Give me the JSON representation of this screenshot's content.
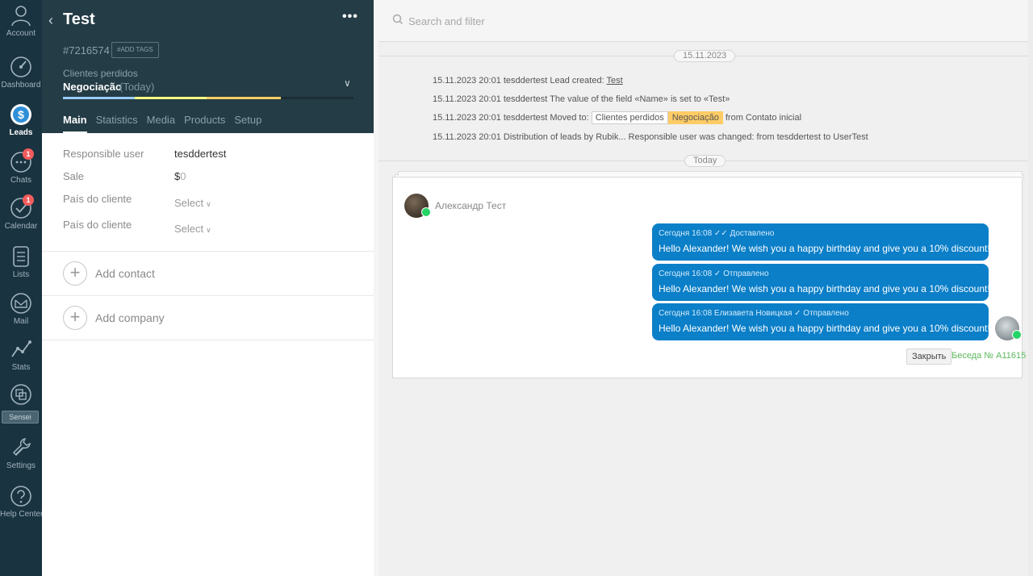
{
  "rail": {
    "items": [
      {
        "label": "Account",
        "icon": "account-icon"
      },
      {
        "label": "Dashboard",
        "icon": "dashboard-icon"
      },
      {
        "label": "Leads",
        "icon": "leads-icon",
        "active": true
      },
      {
        "label": "Chats",
        "icon": "chats-icon",
        "badge": "1"
      },
      {
        "label": "Calendar",
        "icon": "calendar-icon",
        "badge": "1"
      },
      {
        "label": "Lists",
        "icon": "lists-icon"
      },
      {
        "label": "Mail",
        "icon": "mail-icon"
      },
      {
        "label": "Stats",
        "icon": "stats-icon"
      },
      {
        "label": "Sensei",
        "icon": "sensei-icon"
      },
      {
        "label": "Settings",
        "icon": "settings-icon"
      },
      {
        "label": "Help Center",
        "icon": "help-center-icon"
      }
    ],
    "sensei_tag": "Sensei"
  },
  "card": {
    "title": "Test",
    "more": "•••",
    "lead_id": "#7216574",
    "add_tags": "#ADD TAGS",
    "pipeline": "Clientes perdidos",
    "stage": "Negociação",
    "stage_when": "(Today)",
    "stage_progress": 0.75,
    "tabs": [
      "Main",
      "Statistics",
      "Media",
      "Products",
      "Setup"
    ],
    "active_tab": "Main",
    "fields": [
      {
        "label": "Responsible user",
        "value": "tesddertest"
      },
      {
        "label": "Sale",
        "currency": "$",
        "value": "0"
      },
      {
        "label": "País do cliente",
        "value": "Select"
      },
      {
        "label": "País do cliente",
        "value": "Select"
      }
    ],
    "add_contact": "Add contact",
    "add_company": "Add company"
  },
  "feed": {
    "search_placeholder": "Search and filter",
    "date1": "15.11.2023",
    "events": {
      "e1_text": "15.11.2023 20:01 tesddertest Lead created: ",
      "e1_link": "Test",
      "e2_text": "15.11.2023 20:01 tesddertest The value of the field «Name» is set to «Test»",
      "e3_text": "15.11.2023 20:01 tesddertest Moved to: ",
      "e3_chip1": "Clientes perdidos",
      "e3_chip2": "Negociação",
      "e3_tail": " from Contato inicial",
      "e4_text": "15.11.2023 20:01 Distribution of leads by Rubik...  Responsible user was changed: from tesddertest to UserTest"
    },
    "date2": "Today",
    "chat": {
      "contact": "Александр Тест",
      "messages": [
        {
          "meta": "Сегодня 16:08 ✓✓ Доставлено",
          "text": "Hello Alexander! We wish you a happy birthday and give you a 10% discount!"
        },
        {
          "meta": "Сегодня 16:08 ✓ Отправлено",
          "text": "Hello Alexander! We wish you a happy birthday and give you a 10% discount!"
        },
        {
          "meta": "Сегодня 16:08 Елизавета Новицкая ✓ Отправлено",
          "text": "Hello Alexander! We wish you a happy birthday and give you a 10% discount!"
        }
      ],
      "close": "Закрыть",
      "conversation_link": "Беседа № A11615"
    }
  },
  "colors": {
    "rail_bg": "#1a3340",
    "card_head_bg": "#243c46",
    "bubble": "#0b7fc8",
    "stage_chip": "#ffcc66",
    "whatsapp": "#25d366",
    "badge": "#f25c5c"
  }
}
